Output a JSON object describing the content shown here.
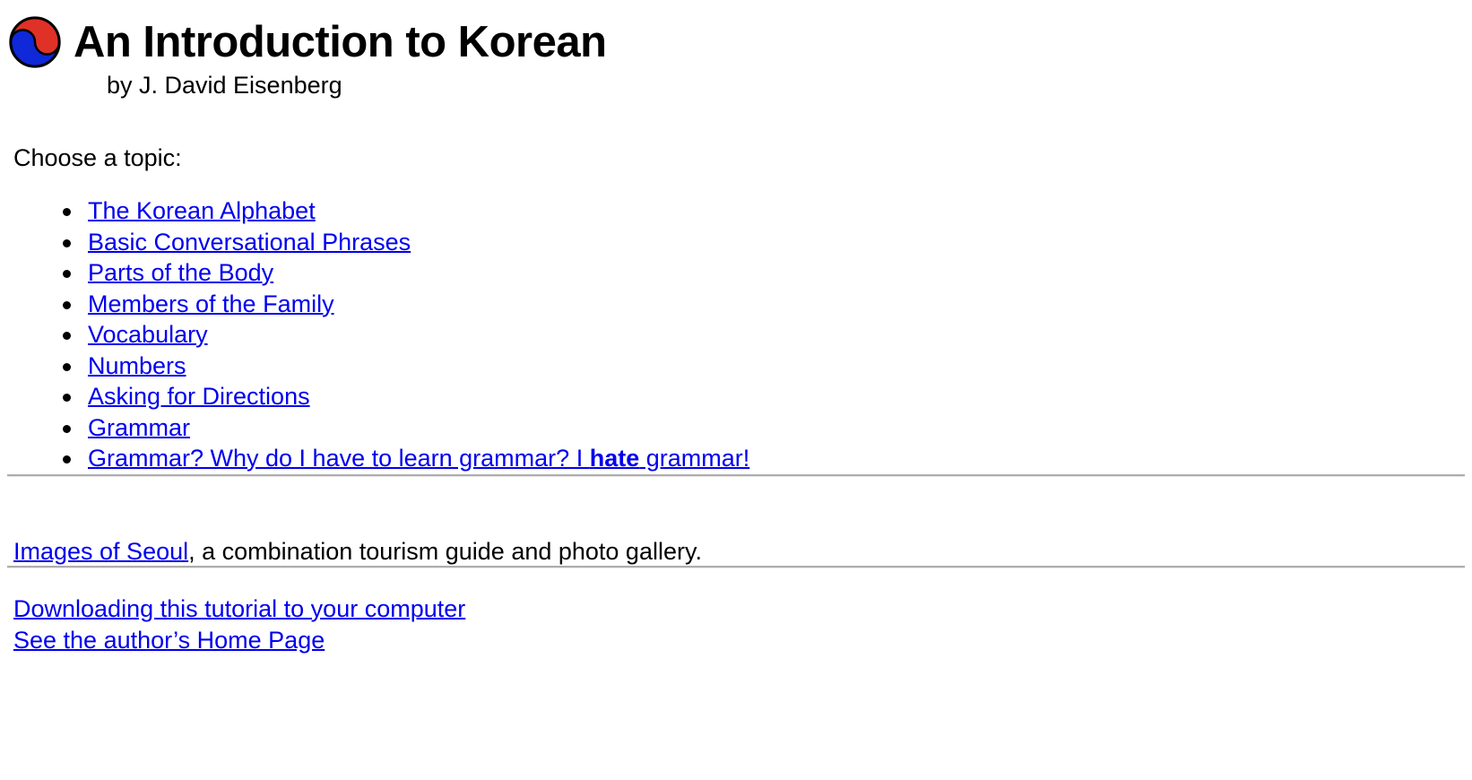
{
  "header": {
    "logo_icon": "taegeuk-icon",
    "logo_colors": {
      "top": "#e03127",
      "bottom": "#0f28d8",
      "outline": "#000000"
    },
    "title": "An Introduction to Korean",
    "byline": "by J. David Eisenberg"
  },
  "main": {
    "lead": "Choose a topic:",
    "topics": [
      {
        "label": "The Korean Alphabet"
      },
      {
        "label": "Basic Conversational Phrases"
      },
      {
        "label": "Parts of the Body"
      },
      {
        "label": "Members of the Family"
      },
      {
        "label": "Vocabulary"
      },
      {
        "label": "Numbers"
      },
      {
        "label": "Asking for Directions"
      },
      {
        "label": "Grammar"
      }
    ],
    "grammar_rant": {
      "prefix": "Grammar? Why do I have to learn grammar? I ",
      "emphasis": "hate",
      "suffix": " grammar!"
    }
  },
  "seoul": {
    "link_label": "Images of Seoul",
    "trailing_text": ", a combination tourism guide and photo gallery."
  },
  "footer": {
    "download_link": "Downloading this tutorial to your computer",
    "author_link": "See the author’s Home Page"
  },
  "colors": {
    "link": "#0000ee",
    "text": "#000000",
    "rule": "#adadad",
    "background": "#ffffff"
  }
}
